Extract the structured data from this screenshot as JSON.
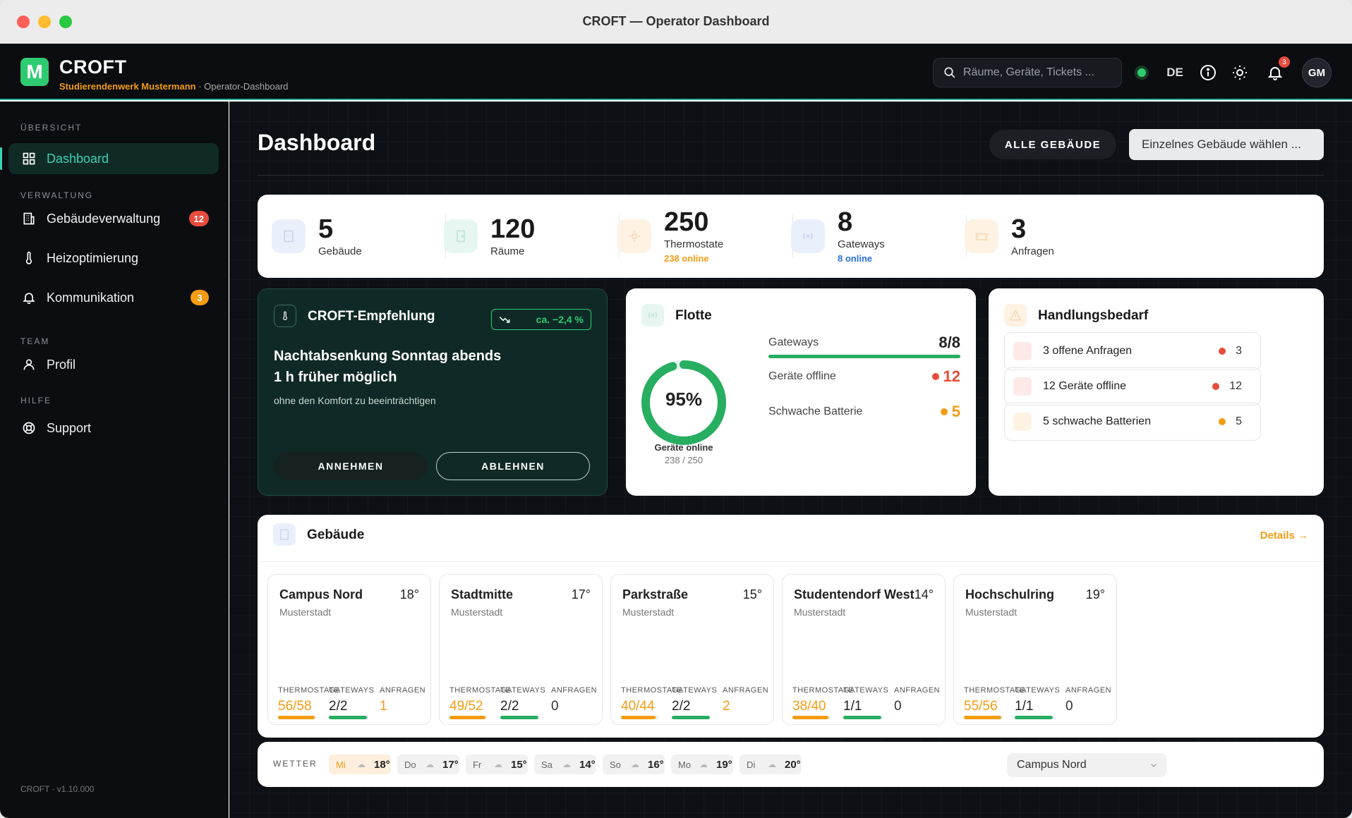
{
  "window": {
    "title": "CROFT — Operator Dashboard"
  },
  "header": {
    "logo_letter": "M",
    "brand": "CROFT",
    "org": "Studierendenwerk Mustermann",
    "crumb": " · Operator-Dashboard",
    "search_placeholder": "Räume, Geräte, Tickets ...",
    "lang": "DE",
    "notifications": "3",
    "avatar": "GM"
  },
  "sidebar": {
    "sections": {
      "overview": "ÜBERSICHT",
      "admin": "VERWALTUNG",
      "team": "TEAM",
      "help": "HILFE"
    },
    "items": [
      {
        "label": "Dashboard"
      },
      {
        "label": "Gebäudeverwaltung",
        "badge": "12"
      },
      {
        "label": "Heizoptimierung"
      },
      {
        "label": "Kommunikation",
        "badge": "3"
      },
      {
        "label": "Profil"
      },
      {
        "label": "Support"
      }
    ],
    "version": "CROFT · v1.10.000"
  },
  "page": {
    "title": "Dashboard",
    "btn_all": "ALLE GEBÄUDE",
    "select_placeholder": "Einzelnes Gebäude wählen ..."
  },
  "stats": [
    {
      "value": "5",
      "label": "Gebäude"
    },
    {
      "value": "120",
      "label": "Räume"
    },
    {
      "value": "250",
      "label": "Thermostate",
      "extra": "238 online"
    },
    {
      "value": "8",
      "label": "Gateways",
      "extra": "8 online"
    },
    {
      "value": "3",
      "label": "Anfragen"
    }
  ],
  "recommendation": {
    "title": "CROFT-Empfehlung",
    "saving": "ca. −2,4 %",
    "headline1": "Nachtabsenkung Sonntag abends",
    "headline2": "1 h früher möglich",
    "subtext": "ohne den Komfort zu beeinträchtigen",
    "accept": "ANNEHMEN",
    "decline": "ABLEHNEN"
  },
  "fleet": {
    "title": "Flotte",
    "percent_label": "95%",
    "online_fraction": 0.952,
    "online_label": "Geräte online",
    "online_count": "238 / 250",
    "rows": [
      {
        "label": "Gateways",
        "value": "8/8"
      },
      {
        "label": "Geräte offline",
        "value": "12"
      },
      {
        "label": "Schwache Batterie",
        "value": "5"
      }
    ],
    "gateway_fraction": 1.0
  },
  "actions": {
    "title": "Handlungsbedarf",
    "items": [
      {
        "label": "3 offene Anfragen",
        "count": "3"
      },
      {
        "label": "12 Geräte offline",
        "count": "12"
      },
      {
        "label": "5 schwache Batterien",
        "count": "5"
      }
    ]
  },
  "buildings": {
    "title": "Gebäude",
    "details": "Details →",
    "metric_headers": {
      "thermo": "THERMOSTATE",
      "gw": "GATEWAYS",
      "req": "ANFRAGEN"
    },
    "items": [
      {
        "name": "Campus Nord",
        "temp": "18°",
        "city": "Musterstadt",
        "thermo": "56/58",
        "thermo_frac": 0.966,
        "gw": "2/2",
        "gw_frac": 1.0,
        "req": "1"
      },
      {
        "name": "Stadtmitte",
        "temp": "17°",
        "city": "Musterstadt",
        "thermo": "49/52",
        "thermo_frac": 0.942,
        "gw": "2/2",
        "gw_frac": 1.0,
        "req": "0"
      },
      {
        "name": "Parkstraße",
        "temp": "15°",
        "city": "Musterstadt",
        "thermo": "40/44",
        "thermo_frac": 0.909,
        "gw": "2/2",
        "gw_frac": 1.0,
        "req": "2"
      },
      {
        "name": "Studentendorf West",
        "temp": "14°",
        "city": "Musterstadt",
        "thermo": "38/40",
        "thermo_frac": 0.95,
        "gw": "1/1",
        "gw_frac": 1.0,
        "req": "0"
      },
      {
        "name": "Hochschulring",
        "temp": "19°",
        "city": "Musterstadt",
        "thermo": "55/56",
        "thermo_frac": 0.982,
        "gw": "1/1",
        "gw_frac": 1.0,
        "req": "0"
      }
    ]
  },
  "weather": {
    "label": "WETTER",
    "days": [
      {
        "day": "Mi",
        "temp": "18°"
      },
      {
        "day": "Do",
        "temp": "17°"
      },
      {
        "day": "Fr",
        "temp": "15°"
      },
      {
        "day": "Sa",
        "temp": "14°"
      },
      {
        "day": "So",
        "temp": "16°"
      },
      {
        "day": "Mo",
        "temp": "19°"
      },
      {
        "day": "Di",
        "temp": "20°"
      }
    ],
    "location": "Campus Nord"
  },
  "colors": {
    "accent": "#3ad1b6",
    "green": "#2ecc71",
    "orange": "#f39c12",
    "red": "#e74c3c",
    "blue": "#2a6fd6"
  }
}
